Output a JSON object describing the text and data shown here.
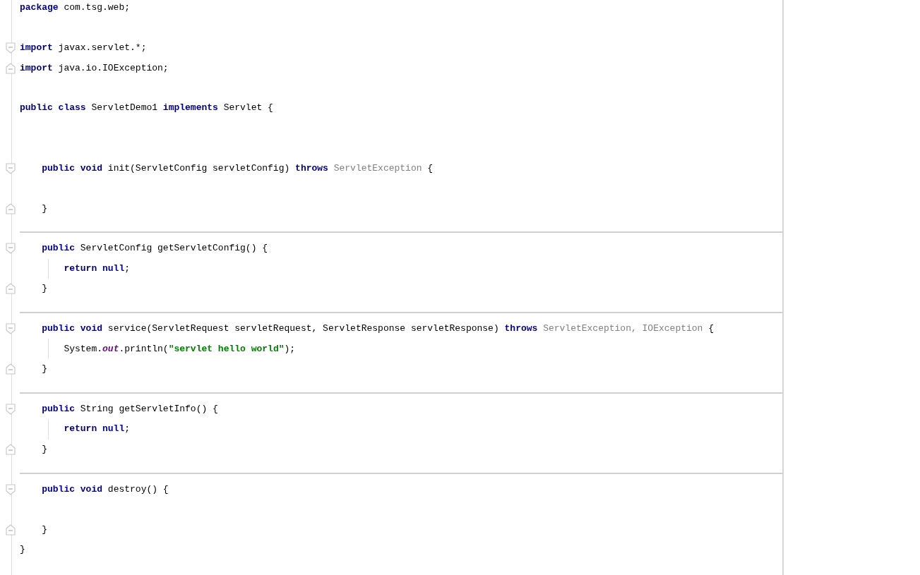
{
  "editor": {
    "lines": [
      {
        "kind": "code",
        "tokens": [
          {
            "kind": "keyword",
            "text": "package"
          },
          {
            "kind": "plain",
            "text": " com.tsg.web;"
          }
        ]
      },
      {
        "kind": "blank"
      },
      {
        "kind": "code",
        "fold_start": true,
        "tokens": [
          {
            "kind": "keyword",
            "text": "import"
          },
          {
            "kind": "plain",
            "text": " javax.servlet.*;"
          }
        ]
      },
      {
        "kind": "code",
        "fold_end": true,
        "tokens": [
          {
            "kind": "keyword",
            "text": "import"
          },
          {
            "kind": "plain",
            "text": " java.io.IOException;"
          }
        ]
      },
      {
        "kind": "blank"
      },
      {
        "kind": "code",
        "tokens": [
          {
            "kind": "keyword",
            "text": "public class"
          },
          {
            "kind": "plain",
            "text": " ServletDemo1 "
          },
          {
            "kind": "keyword",
            "text": "implements"
          },
          {
            "kind": "plain",
            "text": " Servlet {"
          }
        ]
      },
      {
        "kind": "blank"
      },
      {
        "kind": "blank"
      },
      {
        "kind": "code",
        "fold_start": true,
        "tokens": [
          {
            "kind": "keyword",
            "text": "    public void"
          },
          {
            "kind": "plain",
            "text": " init(ServletConfig servletConfig) "
          },
          {
            "kind": "keyword",
            "text": "throws"
          },
          {
            "kind": "muted",
            "text": " ServletException"
          },
          {
            "kind": "plain",
            "text": " {"
          }
        ]
      },
      {
        "kind": "blank"
      },
      {
        "kind": "code",
        "fold_end": true,
        "tokens": [
          {
            "kind": "plain",
            "text": "    }"
          }
        ]
      },
      {
        "kind": "blank"
      },
      {
        "kind": "code",
        "fold_start": true,
        "separator": true,
        "tokens": [
          {
            "kind": "keyword",
            "text": "    public"
          },
          {
            "kind": "plain",
            "text": " ServletConfig getServletConfig() {"
          }
        ]
      },
      {
        "kind": "code",
        "guide": true,
        "tokens": [
          {
            "kind": "keyword",
            "text": "        return null"
          },
          {
            "kind": "plain",
            "text": ";"
          }
        ]
      },
      {
        "kind": "code",
        "fold_end": true,
        "tokens": [
          {
            "kind": "plain",
            "text": "    }"
          }
        ]
      },
      {
        "kind": "blank"
      },
      {
        "kind": "code",
        "fold_start": true,
        "separator": true,
        "tokens": [
          {
            "kind": "keyword",
            "text": "    public void"
          },
          {
            "kind": "plain",
            "text": " service(ServletRequest servletRequest, ServletResponse servletResponse) "
          },
          {
            "kind": "keyword",
            "text": "throws"
          },
          {
            "kind": "muted",
            "text": " ServletException, IOException"
          },
          {
            "kind": "plain",
            "text": " {"
          }
        ]
      },
      {
        "kind": "code",
        "guide": true,
        "tokens": [
          {
            "kind": "plain",
            "text": "        System."
          },
          {
            "kind": "static",
            "text": "out"
          },
          {
            "kind": "plain",
            "text": ".println("
          },
          {
            "kind": "string",
            "text": "\"servlet hello world\""
          },
          {
            "kind": "plain",
            "text": ");"
          }
        ]
      },
      {
        "kind": "code",
        "fold_end": true,
        "tokens": [
          {
            "kind": "plain",
            "text": "    }"
          }
        ]
      },
      {
        "kind": "blank"
      },
      {
        "kind": "code",
        "fold_start": true,
        "separator": true,
        "tokens": [
          {
            "kind": "keyword",
            "text": "    public"
          },
          {
            "kind": "plain",
            "text": " String getServletInfo() {"
          }
        ]
      },
      {
        "kind": "code",
        "guide": true,
        "tokens": [
          {
            "kind": "keyword",
            "text": "        return null"
          },
          {
            "kind": "plain",
            "text": ";"
          }
        ]
      },
      {
        "kind": "code",
        "fold_end": true,
        "tokens": [
          {
            "kind": "plain",
            "text": "    }"
          }
        ]
      },
      {
        "kind": "blank"
      },
      {
        "kind": "code",
        "fold_start": true,
        "separator": true,
        "tokens": [
          {
            "kind": "keyword",
            "text": "    public void"
          },
          {
            "kind": "plain",
            "text": " destroy() {"
          }
        ]
      },
      {
        "kind": "blank"
      },
      {
        "kind": "code",
        "fold_end": true,
        "tokens": [
          {
            "kind": "plain",
            "text": "    }"
          }
        ]
      },
      {
        "kind": "code",
        "tokens": [
          {
            "kind": "plain",
            "text": "}"
          }
        ]
      }
    ]
  }
}
